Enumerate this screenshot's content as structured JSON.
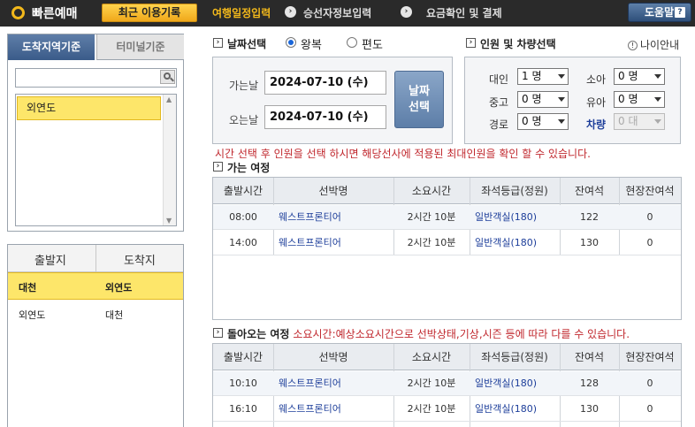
{
  "header": {
    "brand": "빠른예매",
    "recent_button": "최근 이용기록",
    "steps": [
      "여행일정입력",
      "승선자정보입력",
      "요금확인 및 결제"
    ],
    "help_button": "도움말",
    "help_icon_text": "?"
  },
  "left": {
    "tabs": [
      "도착지역기준",
      "터미널기준"
    ],
    "search_value": "",
    "destinations": [
      "외연도"
    ]
  },
  "routes": {
    "headers": [
      "출발지",
      "도착지"
    ],
    "rows": [
      {
        "from": "대천",
        "to": "외연도",
        "selected": true
      },
      {
        "from": "외연도",
        "to": "대천",
        "selected": false
      }
    ]
  },
  "date": {
    "title": "날짜선택",
    "options": [
      "왕복",
      "편도"
    ],
    "selected_option": "왕복",
    "depart_label": "가는날",
    "depart_value": "2024-07-10 (수)",
    "return_label": "오는날",
    "return_value": "2024-07-10 (수)",
    "button_line1": "날짜",
    "button_line2": "선택"
  },
  "passengers": {
    "title": "인원 및 차량선택",
    "age_guide": "나이안내",
    "age_guide_icon": "!",
    "fields": [
      {
        "label": "대인",
        "value": "1 명"
      },
      {
        "label": "소아",
        "value": "0 명"
      },
      {
        "label": "중고",
        "value": "0 명"
      },
      {
        "label": "유아",
        "value": "0 명"
      },
      {
        "label": "경로",
        "value": "0 명"
      },
      {
        "label": "차량",
        "value": "0 대"
      }
    ]
  },
  "notice": "시간 선택 후 인원을 선택 하시면 해당선사에 적용된 최대인원을 확인 할 수 있습니다.",
  "outbound": {
    "title": "가는 여정",
    "columns": [
      "출발시간",
      "선박명",
      "소요시간",
      "좌석등급(정원)",
      "잔여석",
      "현장잔여석"
    ],
    "rows": [
      {
        "time": "08:00",
        "ship": "웨스트프론티어",
        "duration": "2시간 10분",
        "grade": "일반객실(180)",
        "remain": "122",
        "onsite": "0"
      },
      {
        "time": "14:00",
        "ship": "웨스트프론티어",
        "duration": "2시간 10분",
        "grade": "일반객실(180)",
        "remain": "130",
        "onsite": "0"
      }
    ]
  },
  "inbound": {
    "title": "돌아오는 여정",
    "note": "소요시간:예상소요시간으로 선박상태,기상,시즌 등에 따라 다를 수 있습니다.",
    "columns": [
      "출발시간",
      "선박명",
      "소요시간",
      "좌석등급(정원)",
      "잔여석",
      "현장잔여석"
    ],
    "rows": [
      {
        "time": "10:10",
        "ship": "웨스트프론티어",
        "duration": "2시간 10분",
        "grade": "일반객실(180)",
        "remain": "128",
        "onsite": "0"
      },
      {
        "time": "16:10",
        "ship": "웨스트프론티어",
        "duration": "2시간 10분",
        "grade": "일반객실(180)",
        "remain": "130",
        "onsite": "0"
      }
    ]
  },
  "colors": {
    "accent_yellow": "#f2b81b",
    "selected_row": "#fde66a",
    "tab_blue": "#3a5b89",
    "notice_red": "#c0272d",
    "link_blue": "#1d3e9a"
  },
  "icons": {
    "logo": "circle-logo-icon",
    "step_arrow": "chevron-right-icon",
    "search": "search-icon",
    "section": "section-arrow-icon",
    "dropdown": "chevron-down-icon"
  }
}
